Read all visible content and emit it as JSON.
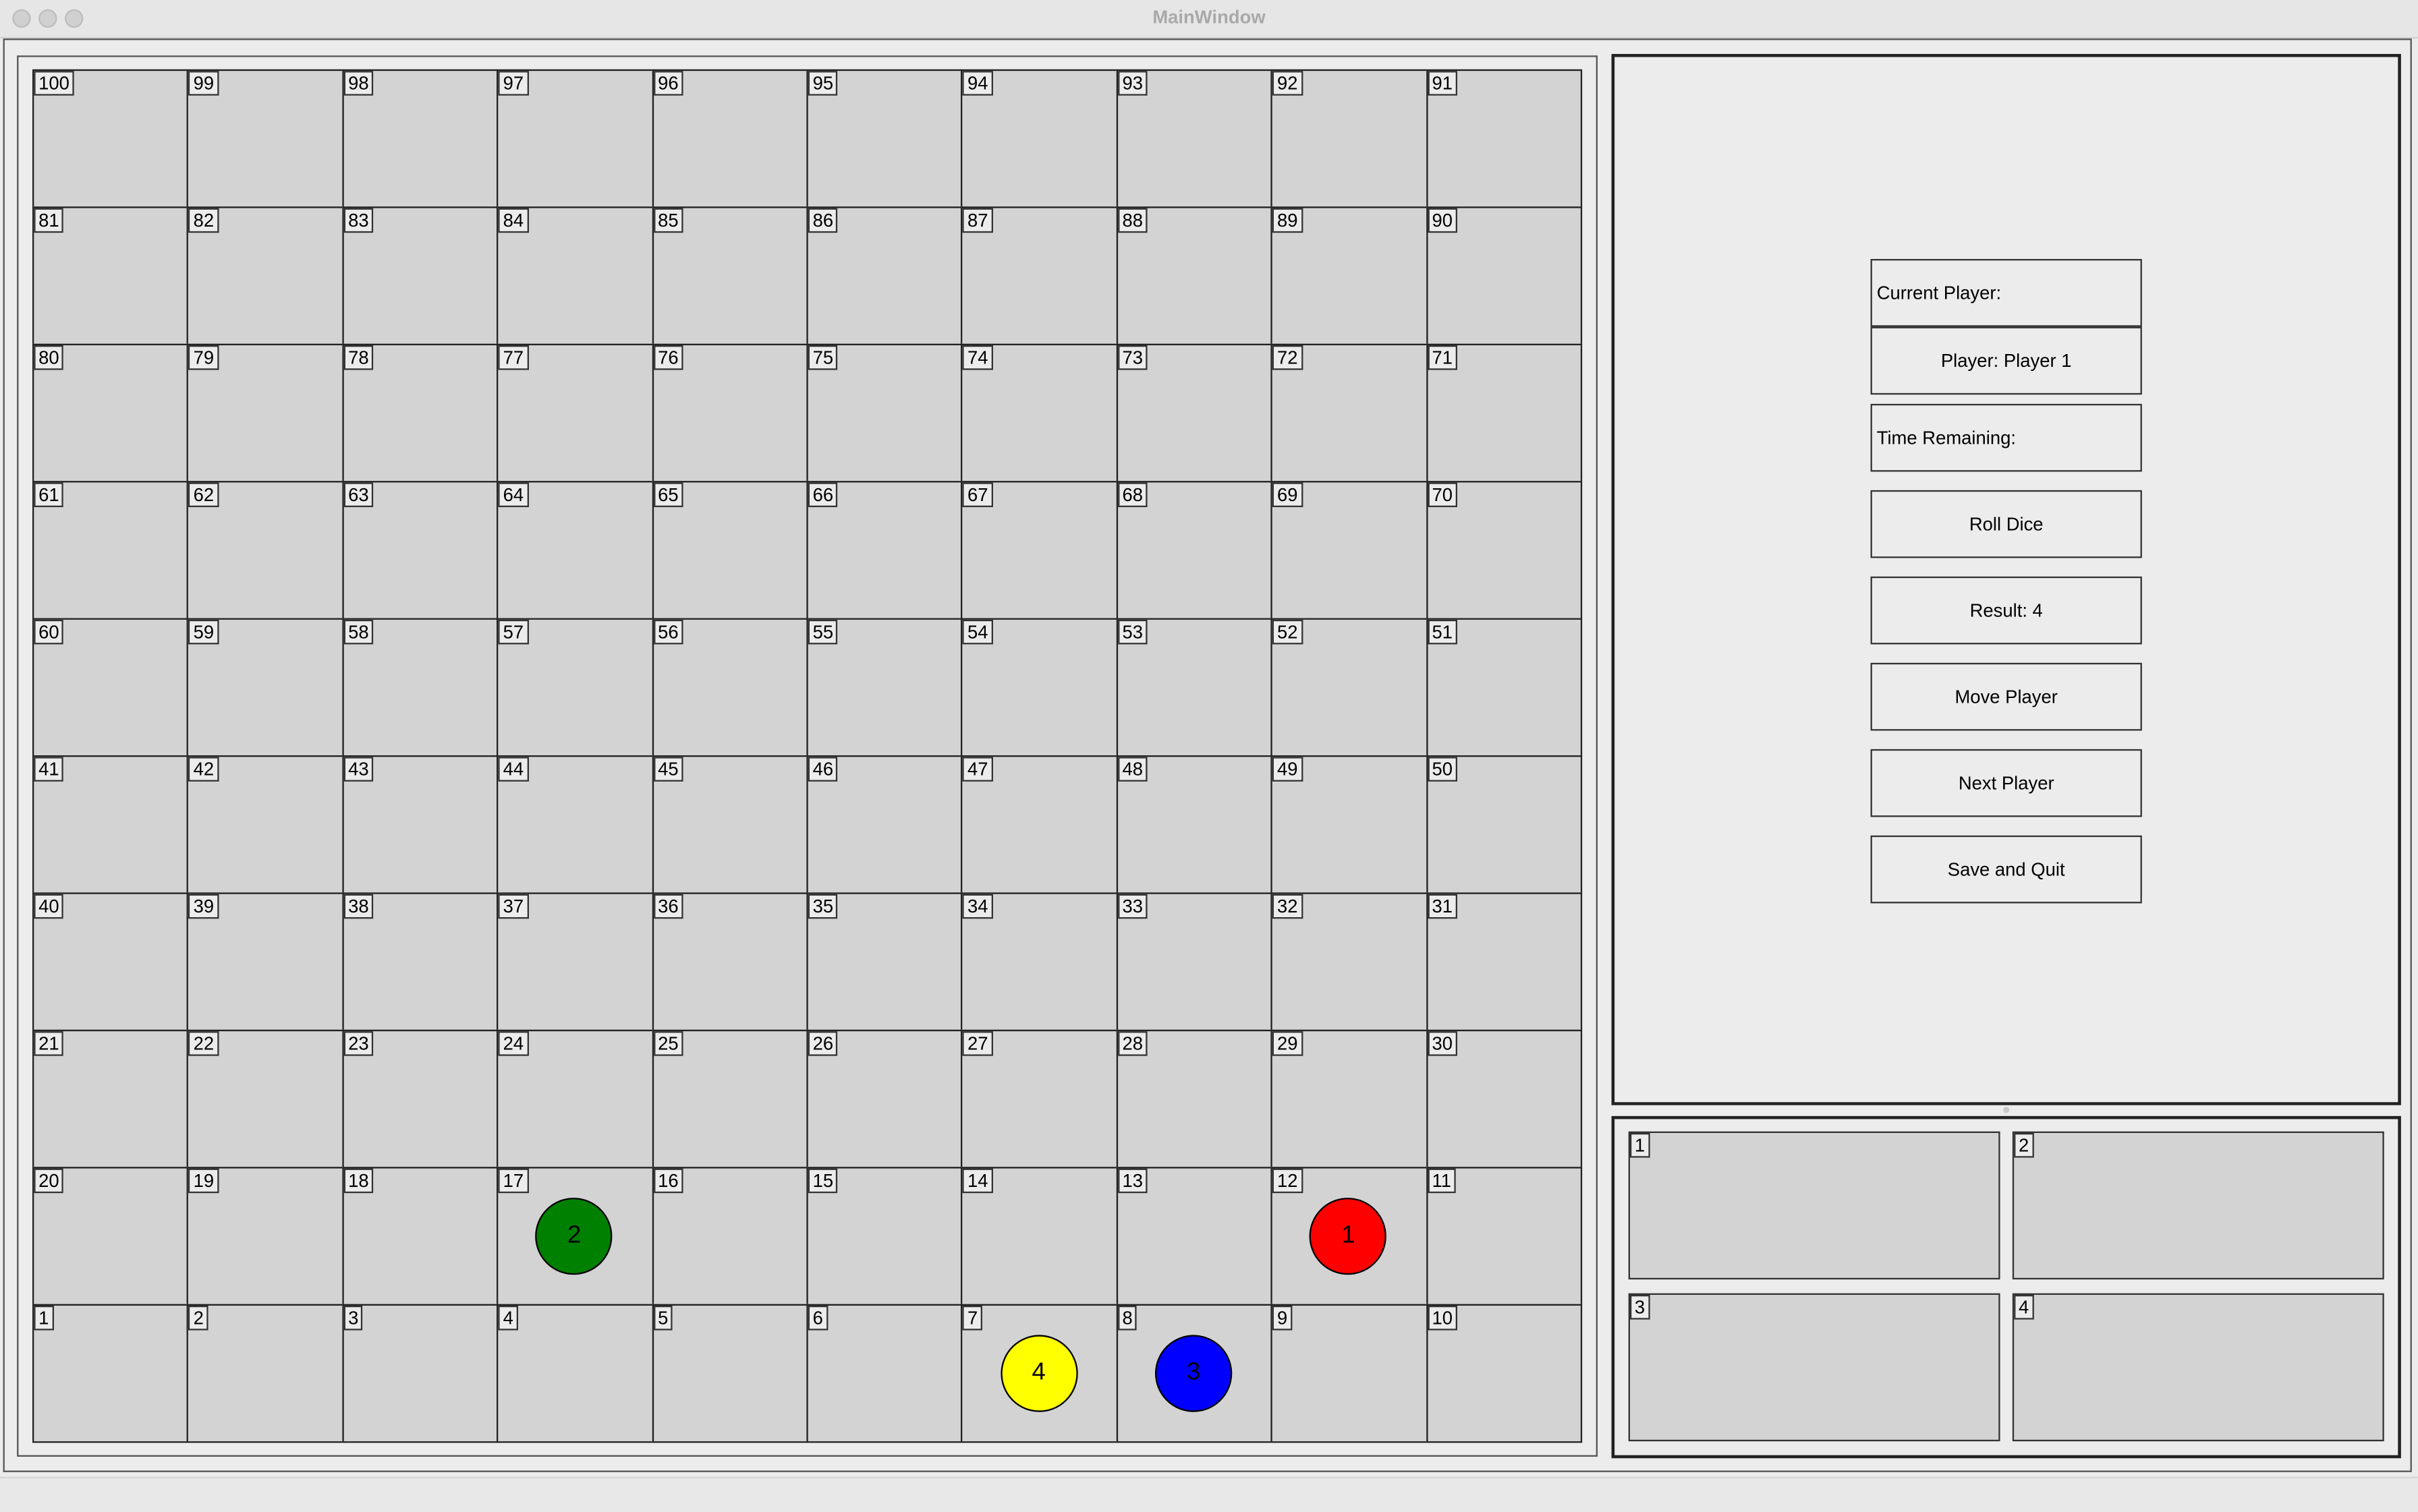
{
  "window": {
    "title": "MainWindow"
  },
  "board": {
    "rows": [
      [
        100,
        99,
        98,
        97,
        96,
        95,
        94,
        93,
        92,
        91
      ],
      [
        81,
        82,
        83,
        84,
        85,
        86,
        87,
        88,
        89,
        90
      ],
      [
        80,
        79,
        78,
        77,
        76,
        75,
        74,
        73,
        72,
        71
      ],
      [
        61,
        62,
        63,
        64,
        65,
        66,
        67,
        68,
        69,
        70
      ],
      [
        60,
        59,
        58,
        57,
        56,
        55,
        54,
        53,
        52,
        51
      ],
      [
        41,
        42,
        43,
        44,
        45,
        46,
        47,
        48,
        49,
        50
      ],
      [
        40,
        39,
        38,
        37,
        36,
        35,
        34,
        33,
        32,
        31
      ],
      [
        21,
        22,
        23,
        24,
        25,
        26,
        27,
        28,
        29,
        30
      ],
      [
        20,
        19,
        18,
        17,
        16,
        15,
        14,
        13,
        12,
        11
      ],
      [
        1,
        2,
        3,
        4,
        5,
        6,
        7,
        8,
        9,
        10
      ]
    ],
    "tokens": [
      {
        "label": "1",
        "cell": 12,
        "color": "#ff0000"
      },
      {
        "label": "2",
        "cell": 17,
        "color": "#008000"
      },
      {
        "label": "3",
        "cell": 8,
        "color": "#0000ff"
      },
      {
        "label": "4",
        "cell": 7,
        "color": "#ffff00"
      }
    ]
  },
  "controls": {
    "current_player_label": "Current Player:",
    "player_value": "Player: Player 1",
    "time_remaining_label": "Time Remaining:",
    "roll_dice": "Roll Dice",
    "result": "Result: 4",
    "move_player": "Move Player",
    "next_player": "Next Player",
    "save_and_quit": "Save and Quit"
  },
  "player_cards": [
    "1",
    "2",
    "3",
    "4"
  ]
}
